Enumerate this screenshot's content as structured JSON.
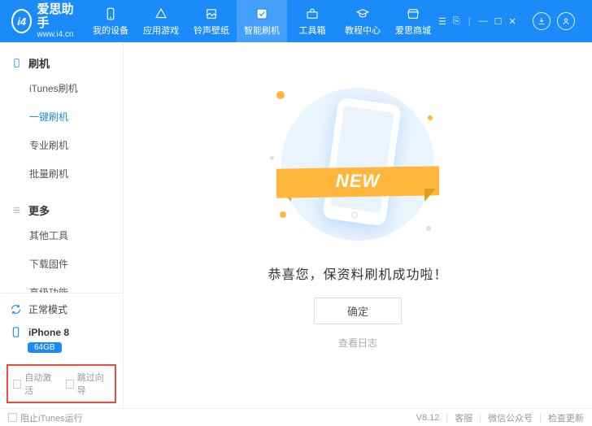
{
  "brand": {
    "name": "爱思助手",
    "url": "www.i4.cn",
    "logo_text": "i4"
  },
  "nav": {
    "my_device": "我的设备",
    "apps_games": "应用游戏",
    "ringtones": "铃声壁纸",
    "flash": "智能刷机",
    "toolbox": "工具箱",
    "tutorials": "教程中心",
    "mall": "爱思商城"
  },
  "sidebar": {
    "flash": {
      "title": "刷机",
      "items": [
        "iTunes刷机",
        "一键刷机",
        "专业刷机",
        "批量刷机"
      ],
      "active_index": 1
    },
    "more": {
      "title": "更多",
      "items": [
        "其他工具",
        "下载固件",
        "高级功能"
      ]
    },
    "status": {
      "mode": "正常模式",
      "device": "iPhone 8",
      "capacity": "64GB"
    },
    "checks": {
      "auto_activate": "自动激活",
      "skip_wizard": "跳过向导"
    }
  },
  "main": {
    "ribbon": "NEW",
    "success": "恭喜您，保资料刷机成功啦！",
    "ok": "确定",
    "view_log": "查看日志"
  },
  "footer": {
    "prevent_itunes": "阻止iTunes运行",
    "version": "V8.12",
    "support": "客服",
    "wechat": "微信公众号",
    "check_update": "检查更新"
  },
  "icons": {
    "download": "download-icon",
    "user": "user-icon"
  }
}
